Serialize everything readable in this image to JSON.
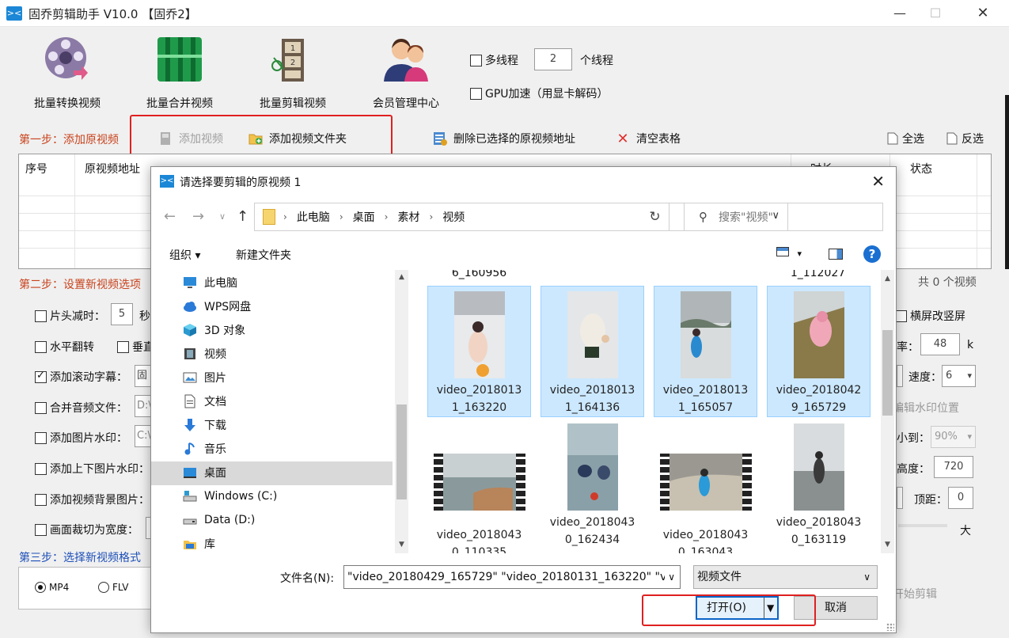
{
  "app": {
    "title": "固乔剪辑助手 V10.0 【固乔2】",
    "logo": "><"
  },
  "window_controls": {
    "minimize": "—",
    "maximize": "☐",
    "close": "✕"
  },
  "toolbar": [
    {
      "label": "批量转换视频",
      "icon": "film-reel-icon"
    },
    {
      "label": "批量合并视频",
      "icon": "merge-video-icon"
    },
    {
      "label": "批量剪辑视频",
      "icon": "clapper-icon"
    },
    {
      "label": "会员管理中心",
      "icon": "members-icon"
    }
  ],
  "threads": {
    "multi_label": "多线程",
    "count": "2",
    "suffix": "个线程",
    "gpu_label": "GPU加速（用显卡解码）"
  },
  "step1": {
    "label": "第一步：添加原视频",
    "add_video": "添加视频",
    "add_folder": "添加视频文件夹",
    "delete_selected": "删除已选择的原视频地址",
    "clear_table": "清空表格",
    "select_all": "全选",
    "invert": "反选"
  },
  "grid": {
    "col_index": "序号",
    "col_path": "原视频地址",
    "col_duration": "时长",
    "col_status": "状态"
  },
  "step2": {
    "label": "第二步：设置新视频选项",
    "total": "共 0 个视频",
    "head_cut_label": "片头减时：",
    "head_cut_value": "5",
    "head_cut_unit": "秒",
    "flip_h": "水平翻转",
    "flip_v": "垂直",
    "scroll_text": "添加滚动字幕：",
    "scroll_text_value": "固",
    "merge_audio": "合并音频文件：",
    "merge_audio_value": "D:\\",
    "image_watermark": "添加图片水印：",
    "image_watermark_value": "C:\\",
    "tb_watermark": "添加上下图片水印：",
    "bg_image": "添加视频背景图片：",
    "crop_width": "画面裁切为宽度：",
    "landscape_to_portrait": "横屏改竖屏",
    "bitrate_label": "率：",
    "bitrate_value": "48",
    "bitrate_unit": "k",
    "speed_label": "速度：",
    "speed_value": "6",
    "edit_watermark_pos": "编辑水印位置",
    "shrink_label": "小到：",
    "shrink_value": "90%",
    "height_label": "高度：",
    "height_value": "720",
    "top_margin_label": "顶距：",
    "top_margin_value": "0",
    "size_big": "大"
  },
  "step3": {
    "label": "第三步：选择新视频格式",
    "mp4": "MP4",
    "flv": "FLV",
    "start": "开始剪辑"
  },
  "dialog": {
    "title": "请选择要剪辑的原视频 1",
    "breadcrumb": [
      "此电脑",
      "桌面",
      "素材",
      "视频"
    ],
    "search_placeholder": "搜索\"视频\"",
    "organize": "组织 ▾",
    "new_folder": "新建文件夹",
    "help": "?",
    "nav_items": [
      "此电脑",
      "WPS网盘",
      "3D 对象",
      "视频",
      "图片",
      "文档",
      "下载",
      "音乐",
      "桌面",
      "Windows (C:)",
      "Data (D:)",
      "库"
    ],
    "partial_top": [
      "6_160956",
      "1_112027"
    ],
    "files": [
      {
        "line1": "video_2018013",
        "line2": "1_163220",
        "selected": true
      },
      {
        "line1": "video_2018013",
        "line2": "1_164136",
        "selected": true
      },
      {
        "line1": "video_2018013",
        "line2": "1_165057",
        "selected": true
      },
      {
        "line1": "video_2018042",
        "line2": "9_165729",
        "selected": true
      },
      {
        "line1": "video_2018043",
        "line2": "0_110335",
        "selected": false
      },
      {
        "line1": "video_2018043",
        "line2": "0_162434",
        "selected": false
      },
      {
        "line1": "video_2018043",
        "line2": "0_163043",
        "selected": false
      },
      {
        "line1": "video_2018043",
        "line2": "0_163119",
        "selected": false
      }
    ],
    "filename_label": "文件名(N):",
    "filename_value": "\"video_20180429_165729\" \"video_20180131_163220\" \"v",
    "filetype": "视频文件",
    "open": "打开(O)",
    "cancel": "取消"
  },
  "colors": {
    "accent": "#1b87d6",
    "step_red": "#c8431d",
    "step_blue": "#1d4fb8",
    "highlight_box": "#e02020",
    "selection": "#cce8ff"
  }
}
